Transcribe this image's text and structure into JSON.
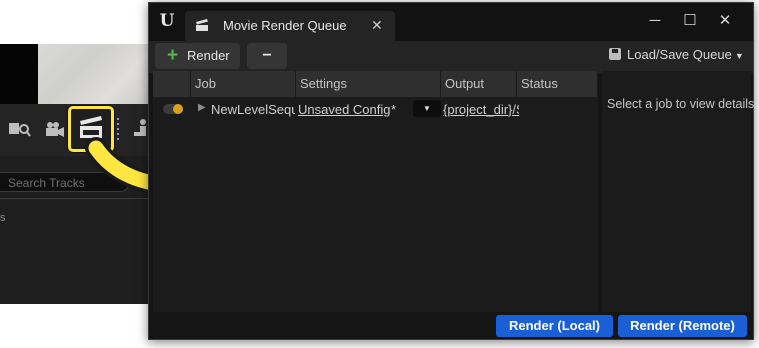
{
  "background": {
    "search_placeholder": "Search Tracks"
  },
  "window": {
    "tab_title": "Movie Render Queue",
    "logo_text": "U",
    "controls": {
      "close_tab": "✕",
      "minimize": "─",
      "maximize": "☐",
      "close": "✕"
    }
  },
  "toolbar": {
    "render_label": "Render",
    "remove_label": "−",
    "load_save_label": "Load/Save Queue"
  },
  "queue": {
    "columns": [
      "Job",
      "Settings",
      "Output",
      "Status"
    ],
    "jobs": [
      {
        "name": "NewLevelSequence",
        "settings": "Unsaved Config",
        "settings_marker": "*",
        "output": "{project_dir}/Saved/MovieRenders/",
        "status": ""
      }
    ]
  },
  "details": {
    "hint": "Select a job to view details"
  },
  "footer": {
    "render_local": "Render (Local)",
    "render_remote": "Render (Remote)"
  },
  "colors": {
    "accent_blue": "#1a5fd6",
    "highlight_yellow": "#ffe640",
    "toggle_orange": "#d9a21c",
    "plus_green": "#56b54a"
  }
}
